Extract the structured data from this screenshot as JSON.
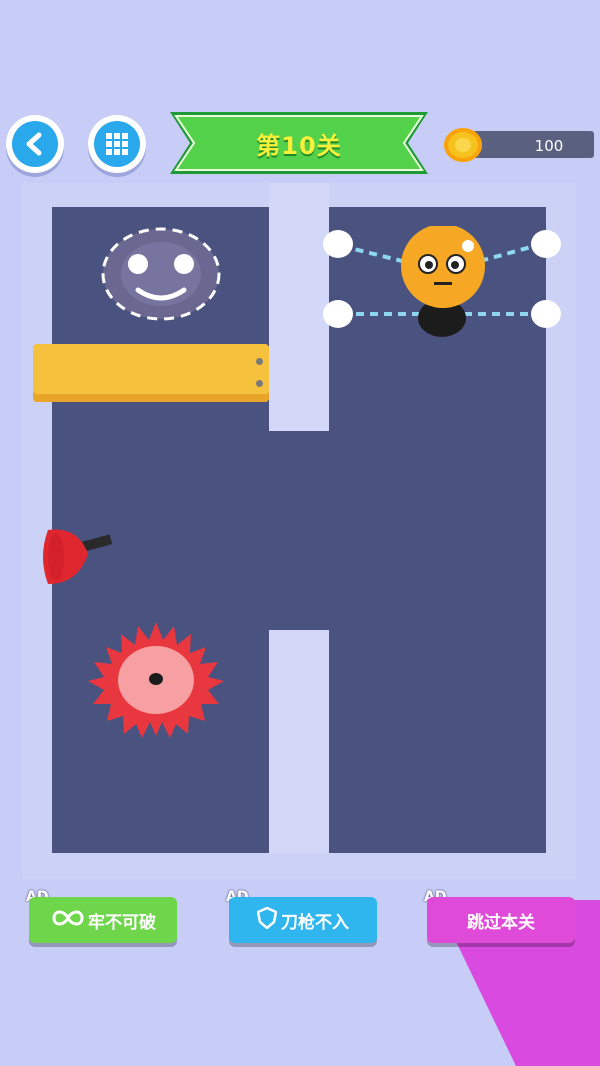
{
  "topbar": {
    "back_icon": "chevron-left-icon",
    "menu_icon": "grid-icon",
    "level_label": "第10关",
    "coins": "100",
    "coin_icon": "coin-icon"
  },
  "game": {
    "ghost_target": "ghost-face",
    "character": "orange-ball-character",
    "hazards": [
      "red-plunger",
      "saw-blade"
    ],
    "platform": "yellow-bar"
  },
  "buttons": [
    {
      "ad": "AD",
      "label": "牢不可破",
      "icon": "infinity-icon",
      "color": "#6fd64c"
    },
    {
      "ad": "AD",
      "label": "刀枪不入",
      "icon": "shield-icon",
      "color": "#2fb6ef"
    },
    {
      "ad": "AD",
      "label": "跳过本关",
      "icon": "",
      "color": "#e04ad8"
    }
  ]
}
